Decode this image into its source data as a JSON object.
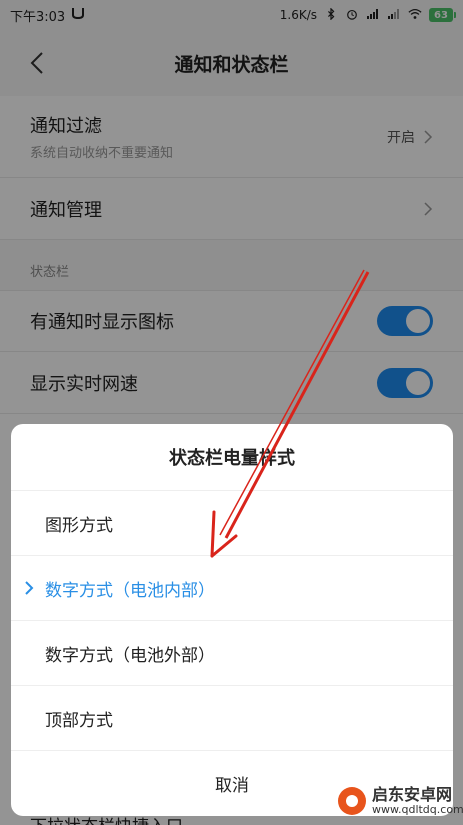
{
  "status_bar": {
    "time": "下午3:03",
    "net_speed": "1.6K/s",
    "battery": "63"
  },
  "header": {
    "title": "通知和状态栏"
  },
  "settings": {
    "notify_filter": {
      "label": "通知过滤",
      "sub": "系统自动收纳不重要通知",
      "value": "开启"
    },
    "notify_manage": {
      "label": "通知管理"
    },
    "section_status_bar": "状态栏",
    "show_icon": {
      "label": "有通知时显示图标",
      "enabled": true
    },
    "show_speed": {
      "label": "显示实时网速",
      "enabled": true
    },
    "peek_item": "下拉状态栏快捷入口"
  },
  "dialog": {
    "title": "状态栏电量样式",
    "options": [
      {
        "label": "图形方式",
        "selected": false
      },
      {
        "label": "数字方式（电池内部）",
        "selected": true
      },
      {
        "label": "数字方式（电池外部）",
        "selected": false
      },
      {
        "label": "顶部方式",
        "selected": false
      }
    ],
    "cancel_label": "取消"
  },
  "watermark": {
    "line1": "启东安卓网",
    "line2": "www.qdltdq.com"
  },
  "colors": {
    "accent": "#2a8fe5",
    "toggle_on": "#1e8cf0",
    "arrow": "#d9241b"
  }
}
